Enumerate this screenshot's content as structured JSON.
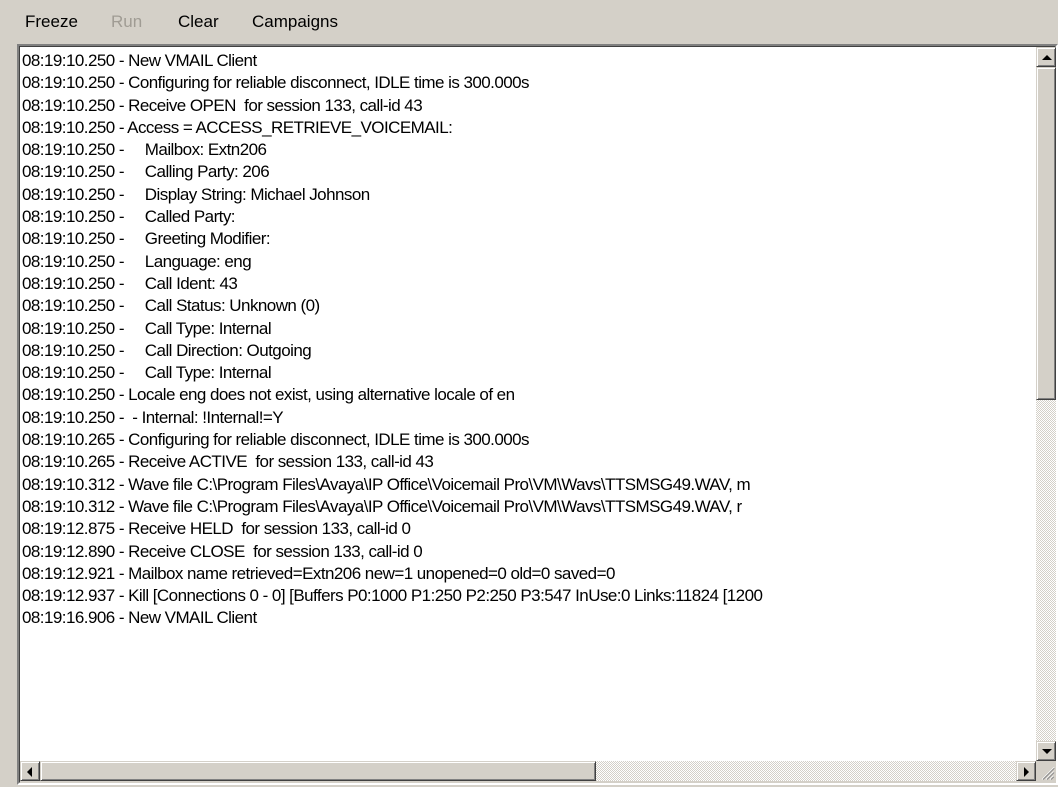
{
  "menu": {
    "freeze": "Freeze",
    "run": "Run",
    "clear": "Clear",
    "campaigns": "Campaigns"
  },
  "log": {
    "lines": [
      "08:19:10.250 - New VMAIL Client",
      "08:19:10.250 - Configuring for reliable disconnect, IDLE time is 300.000s",
      "08:19:10.250 - Receive OPEN  for session 133, call-id 43",
      "08:19:10.250 - Access = ACCESS_RETRIEVE_VOICEMAIL:",
      "08:19:10.250 -     Mailbox: Extn206",
      "08:19:10.250 -     Calling Party: 206",
      "08:19:10.250 -     Display String: Michael Johnson",
      "08:19:10.250 -     Called Party:",
      "08:19:10.250 -     Greeting Modifier:",
      "08:19:10.250 -     Language: eng",
      "08:19:10.250 -     Call Ident: 43",
      "08:19:10.250 -     Call Status: Unknown (0)",
      "08:19:10.250 -     Call Type: Internal",
      "08:19:10.250 -     Call Direction: Outgoing",
      "08:19:10.250 -     Call Type: Internal",
      "08:19:10.250 - Locale eng does not exist, using alternative locale of en",
      "08:19:10.250 -  - Internal: !Internal!=Y",
      "08:19:10.265 - Configuring for reliable disconnect, IDLE time is 300.000s",
      "08:19:10.265 - Receive ACTIVE  for session 133, call-id 43",
      "08:19:10.312 - Wave file C:\\Program Files\\Avaya\\IP Office\\Voicemail Pro\\VM\\Wavs\\TTSMSG49.WAV, m",
      "08:19:10.312 - Wave file C:\\Program Files\\Avaya\\IP Office\\Voicemail Pro\\VM\\Wavs\\TTSMSG49.WAV, r",
      "08:19:12.875 - Receive HELD  for session 133, call-id 0",
      "08:19:12.890 - Receive CLOSE  for session 133, call-id 0",
      "08:19:12.921 - Mailbox name retrieved=Extn206 new=1 unopened=0 old=0 saved=0",
      "08:19:12.937 - Kill [Connections 0 - 0] [Buffers P0:1000 P1:250 P2:250 P3:547 InUse:0 Links:11824 [1200",
      "08:19:16.906 - New VMAIL Client"
    ]
  },
  "icons": {
    "scroll_up": "arrow-up-icon",
    "scroll_down": "arrow-down-icon",
    "scroll_left": "arrow-left-icon",
    "scroll_right": "arrow-right-icon",
    "size_grip": "size-grip-icon"
  },
  "colors": {
    "chrome": "#d4d0c8",
    "log_background": "#ffffff",
    "disabled_text": "#a09c94"
  }
}
